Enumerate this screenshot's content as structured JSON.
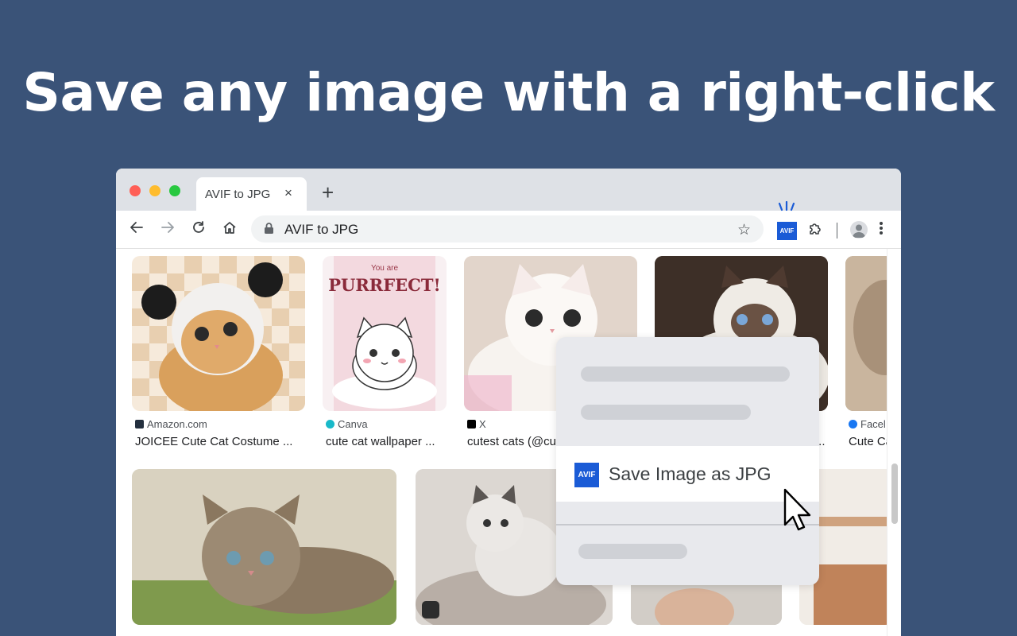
{
  "headline": "Save any image with a right-click",
  "browser": {
    "tab": {
      "title": "AVIF to JPG",
      "close": "×"
    },
    "new_tab": "+",
    "address": "AVIF to JPG",
    "extension_badge": "AVIF"
  },
  "results": [
    {
      "source": "Amazon.com",
      "title": "JOICEE Cute Cat Costume ..."
    },
    {
      "source": "Canva",
      "title": "cute cat wallpaper ..."
    },
    {
      "source": "X",
      "title": "cutest cats (@cu"
    },
    {
      "source": "",
      "title": "..."
    },
    {
      "source": "Facel",
      "title": "Cute Ca"
    }
  ],
  "thumb_text": {
    "card2_line1": "You are",
    "card2_line2": "PURRFECT!"
  },
  "context_menu": {
    "badge": "AVIF",
    "item_label": "Save Image as JPG"
  },
  "colors": {
    "background": "#3a5378",
    "accent": "#1a5bd6"
  }
}
